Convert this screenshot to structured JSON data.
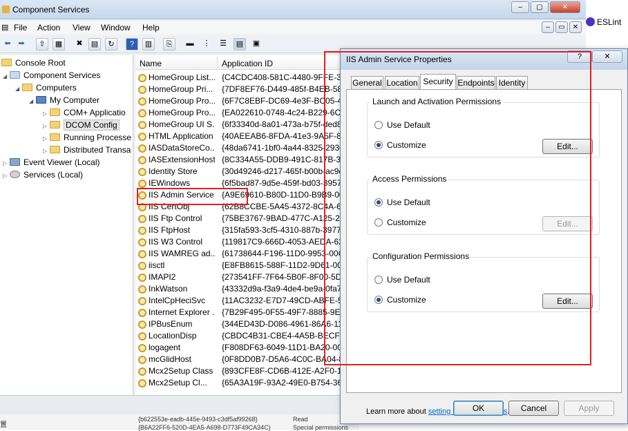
{
  "main_window": {
    "title": "Component Services",
    "menu": [
      "File",
      "Action",
      "View",
      "Window",
      "Help"
    ],
    "tree": {
      "console_root": "Console Root",
      "component_services": "Component Services",
      "computers": "Computers",
      "my_computer": "My Computer",
      "com_apps": "COM+ Applicatio",
      "dcom_config": "DCOM Config",
      "running_processes": "Running Processe",
      "distributed_trans": "Distributed Transa",
      "event_viewer": "Event Viewer (Local)",
      "services": "Services (Local)"
    },
    "columns": {
      "name": "Name",
      "appid": "Application ID"
    },
    "rows": [
      {
        "name": "HomeGroup List...",
        "appid": "{C4CDC408-581C-4480-9FFE-3B1"
      },
      {
        "name": "HomeGroup Pri...",
        "appid": "{7DF8EF76-D449-485f-B4EB-58D"
      },
      {
        "name": "HomeGroup Pro...",
        "appid": "{6F7C8EBF-DC69-4e3F-BC05-439"
      },
      {
        "name": "HomeGroup Pro...",
        "appid": "{EA022610-0748-4c24-B229-6C5"
      },
      {
        "name": "HomeGroup UI S...",
        "appid": "{6f33340d-8a01-473a-b75f-ded8"
      },
      {
        "name": "HTML Application",
        "appid": "{40AEEAB6-8FDA-41e3-9A5F-835"
      },
      {
        "name": "IASDataStoreCo...",
        "appid": "{48da6741-1bf0-4a44-8325-2930"
      },
      {
        "name": "IASExtensionHost",
        "appid": "{8C334A55-DDB9-491C-817B-35A"
      },
      {
        "name": "Identity Store",
        "appid": "{30d49246-d217-465f-b00b-ac9d"
      },
      {
        "name": "IEWindows",
        "appid": "{6f5bad87-9d5e-459f-bd03-3957"
      },
      {
        "name": "IIS Admin Service",
        "appid": "{A9E69610-B80D-11D0-B9B9-00A"
      },
      {
        "name": "IIS CertObj",
        "appid": "{62B8CCBE-5A45-4372-8C4A-6A"
      },
      {
        "name": "IIS Ftp Control",
        "appid": "{75BE3767-9BAD-477C-A125-263"
      },
      {
        "name": "IIS FtpHost",
        "appid": "{315fa593-3cf5-4310-887b-3977a"
      },
      {
        "name": "IIS W3 Control",
        "appid": "{119817C9-666D-4053-AEDA-627"
      },
      {
        "name": "IIS WAMREG ad...",
        "appid": "{61738644-F196-11D0-9953-00C0"
      },
      {
        "name": "iisctl",
        "appid": "{E8FB8615-588F-11D2-9D61-00C0"
      },
      {
        "name": "IMAPI2",
        "appid": "{273541FF-7F64-5B0F-8F00-5D77"
      },
      {
        "name": "InkWatson",
        "appid": "{43332d9a-f3a9-4de4-be9a-0fa73"
      },
      {
        "name": "IntelCpHeciSvc",
        "appid": "{11AC3232-E7D7-49CD-ABFE-501"
      },
      {
        "name": "Internet Explorer ...",
        "appid": "{7B29F495-0F55-49F7-8885-9E8A"
      },
      {
        "name": "IPBusEnum",
        "appid": "{344ED43D-D086-4961-86A6-110"
      },
      {
        "name": "LocationDisp",
        "appid": "{CBDC4B31-CBE4-4A5B-BECF-64"
      },
      {
        "name": "logagent",
        "appid": "{F808DF63-6049-11D1-BA20-006"
      },
      {
        "name": "mcGlidHost",
        "appid": "{0F8DD0B7-D5A6-4C0C-BA04-8A"
      },
      {
        "name": "Mcx2Setup Class",
        "appid": "{893CFE8F-CD6B-412E-A2F0-108"
      },
      {
        "name": "Mcx2Setup Cl...",
        "appid": "{65A3A19F-93A2-49E0-B754-3637"
      }
    ],
    "bottom_strip": {
      "guid1": "{b622553e-eadb-445e-9493-c3df5af99268}",
      "guid2": "{B6A22FF6-520D-4EA5-A698-D773F49CA34C}",
      "read": "Read",
      "special": "Special permissions"
    }
  },
  "side_app": {
    "label": "ESLint"
  },
  "dialog": {
    "title": "IIS Admin Service Properties",
    "help": "?",
    "close": "✕",
    "tabs": [
      "General",
      "Location",
      "Security",
      "Endpoints",
      "Identity"
    ],
    "active_tab": "Security",
    "groups": [
      {
        "label": "Launch and Activation Permissions",
        "use_default": "Use Default",
        "customize": "Customize",
        "edit": "Edit...",
        "selected": "Customize",
        "edit_enabled": true
      },
      {
        "label": "Access Permissions",
        "use_default": "Use Default",
        "customize": "Customize",
        "edit": "Edit...",
        "selected": "Use Default",
        "edit_enabled": false
      },
      {
        "label": "Configuration Permissions",
        "use_default": "Use Default",
        "customize": "Customize",
        "edit": "Edit...",
        "selected": "Customize",
        "edit_enabled": true
      }
    ],
    "learn_prefix": "Learn more about ",
    "learn_link": "setting these properties",
    "learn_suffix": ".",
    "buttons": {
      "ok": "OK",
      "cancel": "Cancel",
      "apply": "Apply"
    }
  },
  "colors": {
    "highlight": "#e0201e",
    "link": "#0066cc"
  }
}
